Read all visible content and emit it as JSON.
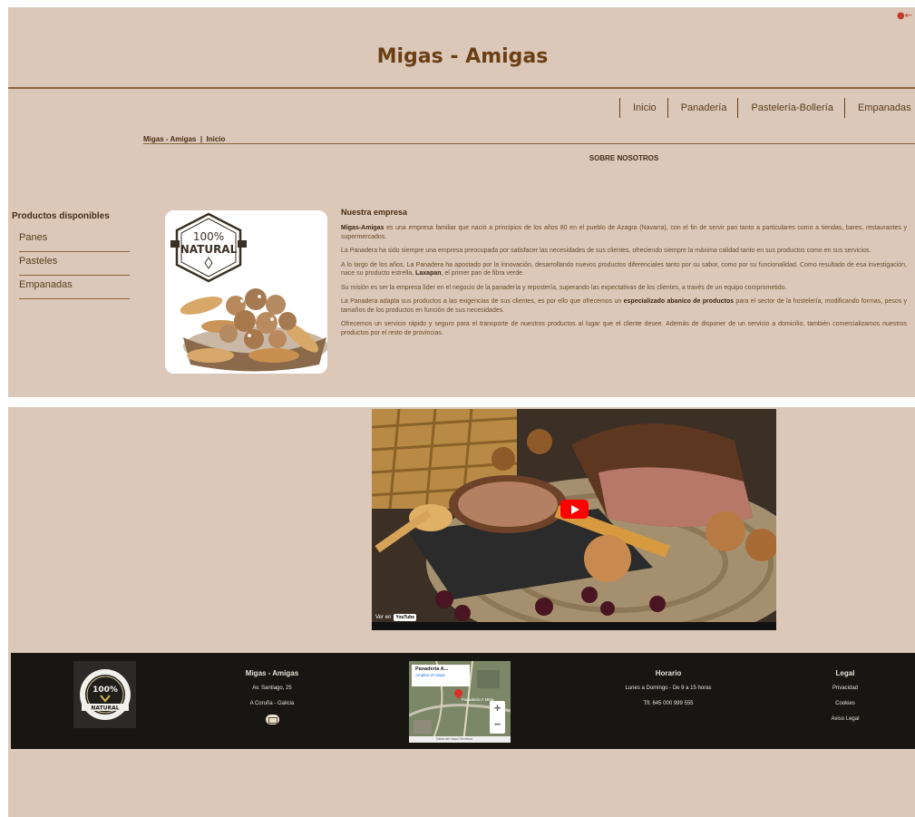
{
  "header": {
    "title": "Migas - Amigas"
  },
  "nav": {
    "items": [
      {
        "label": "Inicio"
      },
      {
        "label": "Panadería"
      },
      {
        "label": "Pastelería-Bollería"
      },
      {
        "label": "Empanadas"
      }
    ]
  },
  "breadcrumb": {
    "text": "Migas - Amigas  |  Inicio"
  },
  "about": {
    "heading": "SOBRE NOSOTROS"
  },
  "sidebar": {
    "title": "Productos disponibles",
    "items": [
      {
        "label": "Panes"
      },
      {
        "label": "Pasteles"
      },
      {
        "label": "Empanadas"
      }
    ]
  },
  "product_badge": {
    "line1": "100%",
    "line2": "NATURAL"
  },
  "company": {
    "title": "Nuestra empresa",
    "p1_bold": "Migas-Amigas",
    "p1_rest": " es una empresa familiar que nació a principios de los años 80 en el pueblo de Azagra (Navarra), con el fin de servir pan tanto a particulares como a tiendas, bares, restaurantes y supermercados.",
    "p2": "La Panadera ha sido siempre una empresa preocupada por satisfacer las necesidades de sus clientes, ofreciendo siempre la máxima calidad tanto en sus productos como en sus servicios.",
    "p3_a": "A lo largo de los años, La Panadera ha apostado por la innovación, desarrollando nuevos productos diferenciales tanto por su sabor, como por su funcionalidad. Como resultado de esa investigación, nace su producto estrella, ",
    "p3_bold": "Laxapan",
    "p3_b": ", el primer pan de fibra verde.",
    "p4": "Su misión es ser la empresa líder en el negocio de la panadería y repostería, superando las expectativas de los clientes, a través de un equipo comprometido.",
    "p5_a": "La Panadera adapta sus productos a las exigencias de sus clientes, es por ello que ofrecemos un ",
    "p5_bold": "especializado abanico de productos",
    "p5_b": " para el sector de la hostelería, modificando formas, pesos y tamaños de los productos en función de sus necesidades.",
    "p6": "Ofrecemos un servicio rápido y seguro para el transporte de nuestros productos al lugar que el cliente desee. Además de disponer de un servicio a domicilio, también comercializamos nuestros productos por el resto de provincias."
  },
  "video": {
    "watch_on": "Ver en",
    "youtube": "YouTube"
  },
  "footer": {
    "logo_line1": "100%",
    "logo_line2": "NATURAL",
    "company_title": "Migas - Amigas",
    "address": "Av. Santiago, 25",
    "region": "A Coruña - Galicia",
    "hours_title": "Horario",
    "hours": "Lunes a Domingo - De 9 a 15 horas",
    "phones": "Tfl. 645 000 999 555",
    "legal_title": "Legal",
    "legal_links": [
      "Privacidad",
      "Cookies",
      "Aviso Legal"
    ],
    "map_name": "Panadería A...",
    "map_enlarge": "Ampliar el mapa",
    "map_place": "Panadería A Miga",
    "map_footer": "Datos del mapa   Términos"
  }
}
